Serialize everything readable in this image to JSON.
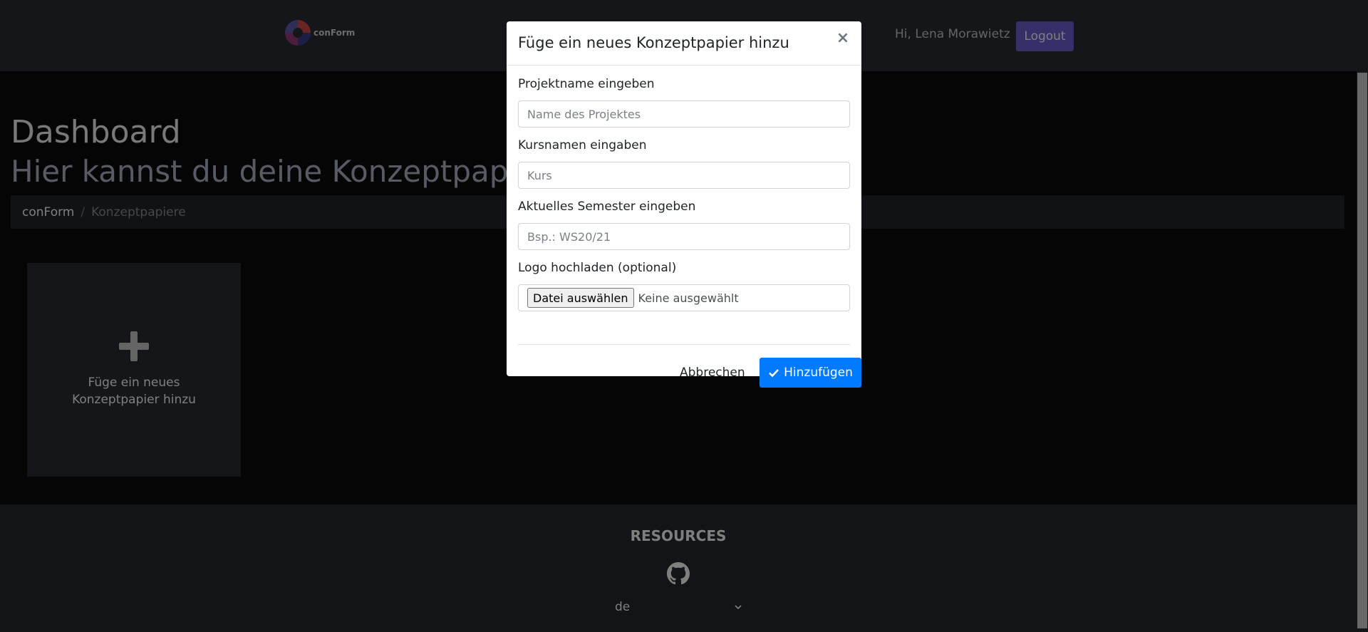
{
  "navbar": {
    "logo_text": "conForm",
    "user_greeting": "Hi, Lena Morawietz",
    "logout_label": "Logout"
  },
  "page": {
    "title": "Dashboard",
    "subtitle": "Hier kannst du deine Konzeptpapiere verwalten"
  },
  "breadcrumb": {
    "home": "conForm",
    "separator": "/",
    "current": "Konzeptpapiere"
  },
  "add_card": {
    "icon": "plus-icon",
    "label": "Füge ein neues Konzeptpapier hinzu"
  },
  "footer": {
    "title": "RESOURCES",
    "icon": "github-icon",
    "language": "de"
  },
  "modal": {
    "title": "Füge ein neues Konzeptpapier hinzu",
    "close_symbol": "×",
    "fields": {
      "project_label": "Projektname eingeben",
      "project_placeholder": "Name des Projektes",
      "course_label": "Kursnamen eingaben",
      "course_placeholder": "Kurs",
      "semester_label": "Aktuelles Semester eingeben",
      "semester_placeholder": "Bsp.: WS20/21",
      "logo_label": "Logo hochladen (optional)",
      "file_button": "Datei auswählen",
      "file_status": "Keine ausgewählt"
    },
    "cancel_label": "Abbrechen",
    "submit_label": "Hinzufügen"
  },
  "colors": {
    "primary": "#007bff",
    "logout": "#6d5fd0",
    "navbar": "#2a2c33"
  }
}
